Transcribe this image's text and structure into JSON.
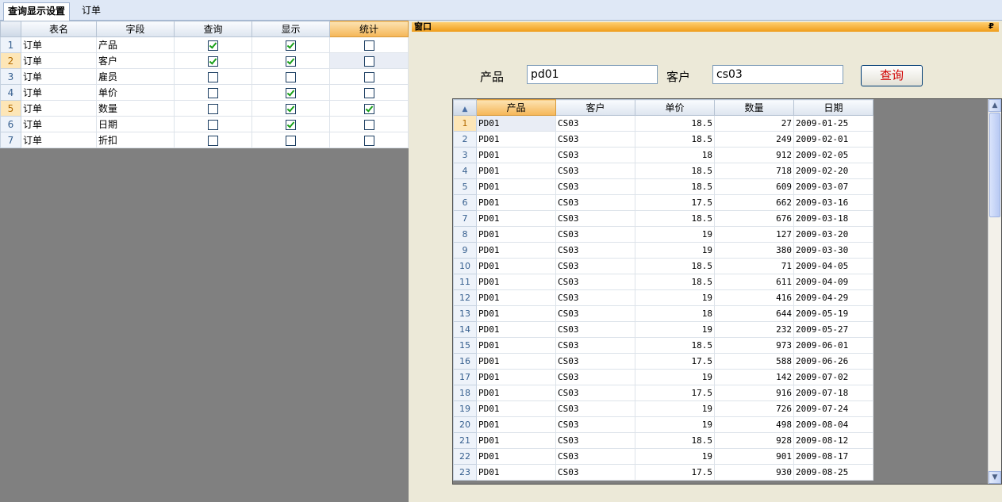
{
  "tabs": [
    "查询显示设置",
    "订单"
  ],
  "left_grid": {
    "columns": [
      "表名",
      "字段",
      "查询",
      "显示",
      "统计"
    ],
    "rows": [
      {
        "n": "1",
        "table": "订单",
        "field": "产品",
        "query": true,
        "show": true,
        "stat": false
      },
      {
        "n": "2",
        "table": "订单",
        "field": "客户",
        "query": true,
        "show": true,
        "stat": false
      },
      {
        "n": "3",
        "table": "订单",
        "field": "雇员",
        "query": false,
        "show": false,
        "stat": false
      },
      {
        "n": "4",
        "table": "订单",
        "field": "单价",
        "query": false,
        "show": true,
        "stat": false
      },
      {
        "n": "5",
        "table": "订单",
        "field": "数量",
        "query": false,
        "show": true,
        "stat": true
      },
      {
        "n": "6",
        "table": "订单",
        "field": "日期",
        "query": false,
        "show": true,
        "stat": false
      },
      {
        "n": "7",
        "table": "订单",
        "field": "折扣",
        "query": false,
        "show": false,
        "stat": false
      }
    ]
  },
  "window": {
    "title": "窗口",
    "pin": "₽",
    "product_label": "产品",
    "product_value": "pd01",
    "customer_label": "客户",
    "customer_value": "cs03",
    "query_button": "查询"
  },
  "result_grid": {
    "columns": [
      "产品",
      "客户",
      "单价",
      "数量",
      "日期"
    ],
    "rows": [
      [
        "1",
        "PD01",
        "CS03",
        "18.5",
        "27",
        "2009-01-25"
      ],
      [
        "2",
        "PD01",
        "CS03",
        "18.5",
        "249",
        "2009-02-01"
      ],
      [
        "3",
        "PD01",
        "CS03",
        "18",
        "912",
        "2009-02-05"
      ],
      [
        "4",
        "PD01",
        "CS03",
        "18.5",
        "718",
        "2009-02-20"
      ],
      [
        "5",
        "PD01",
        "CS03",
        "18.5",
        "609",
        "2009-03-07"
      ],
      [
        "6",
        "PD01",
        "CS03",
        "17.5",
        "662",
        "2009-03-16"
      ],
      [
        "7",
        "PD01",
        "CS03",
        "18.5",
        "676",
        "2009-03-18"
      ],
      [
        "8",
        "PD01",
        "CS03",
        "19",
        "127",
        "2009-03-20"
      ],
      [
        "9",
        "PD01",
        "CS03",
        "19",
        "380",
        "2009-03-30"
      ],
      [
        "10",
        "PD01",
        "CS03",
        "18.5",
        "71",
        "2009-04-05"
      ],
      [
        "11",
        "PD01",
        "CS03",
        "18.5",
        "611",
        "2009-04-09"
      ],
      [
        "12",
        "PD01",
        "CS03",
        "19",
        "416",
        "2009-04-29"
      ],
      [
        "13",
        "PD01",
        "CS03",
        "18",
        "644",
        "2009-05-19"
      ],
      [
        "14",
        "PD01",
        "CS03",
        "19",
        "232",
        "2009-05-27"
      ],
      [
        "15",
        "PD01",
        "CS03",
        "18.5",
        "973",
        "2009-06-01"
      ],
      [
        "16",
        "PD01",
        "CS03",
        "17.5",
        "588",
        "2009-06-26"
      ],
      [
        "17",
        "PD01",
        "CS03",
        "19",
        "142",
        "2009-07-02"
      ],
      [
        "18",
        "PD01",
        "CS03",
        "17.5",
        "916",
        "2009-07-18"
      ],
      [
        "19",
        "PD01",
        "CS03",
        "19",
        "726",
        "2009-07-24"
      ],
      [
        "20",
        "PD01",
        "CS03",
        "19",
        "498",
        "2009-08-04"
      ],
      [
        "21",
        "PD01",
        "CS03",
        "18.5",
        "928",
        "2009-08-12"
      ],
      [
        "22",
        "PD01",
        "CS03",
        "19",
        "901",
        "2009-08-17"
      ],
      [
        "23",
        "PD01",
        "CS03",
        "17.5",
        "930",
        "2009-08-25"
      ]
    ]
  }
}
